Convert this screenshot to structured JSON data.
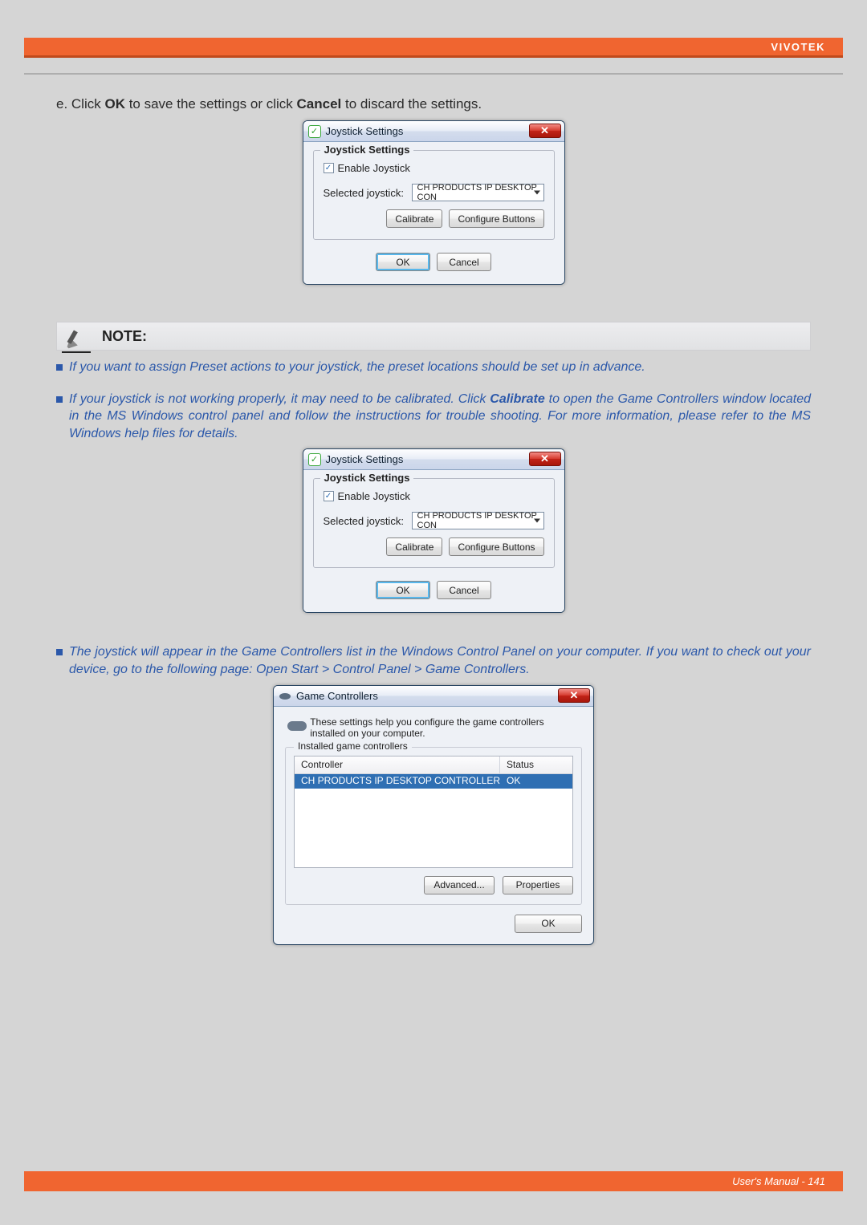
{
  "brand": "VIVOTEK",
  "step_line_pre": "e. Click ",
  "step_line_ok": "OK",
  "step_line_mid": " to save the settings or click ",
  "step_line_cancel": "Cancel",
  "step_line_post": " to discard the settings.",
  "joy_dialog": {
    "title": "Joystick Settings",
    "legend": "Joystick Settings",
    "enable_label": "Enable Joystick",
    "selected_label": "Selected joystick:",
    "selected_value": "CH PRODUCTS IP DESKTOP CON",
    "calibrate": "Calibrate",
    "configure": "Configure Buttons",
    "ok": "OK",
    "cancel": "Cancel"
  },
  "note_label": "NOTE:",
  "bullets": {
    "b1": "If you want to assign Preset actions to your joystick, the preset locations should be set up in advance.",
    "b2_pre": "If your joystick is not working properly, it may need to be calibrated. Click ",
    "b2_cal": "Calibrate",
    "b2_post": " to open the Game Controllers window located in the MS Windows control panel and follow the instructions for trouble shooting. For more information, please refer to the MS Windows help files for details.",
    "b3": "The joystick will appear in the Game Controllers list in the Windows Control Panel on your computer. If you want to check out your device, go to the following page: Open Start > Control Panel > Game Controllers."
  },
  "game_controllers": {
    "title": "Game Controllers",
    "description": "These settings help you configure the game controllers installed on your computer.",
    "legend": "Installed game controllers",
    "col_controller": "Controller",
    "col_status": "Status",
    "row_controller": "CH PRODUCTS IP DESKTOP CONTROLLER",
    "row_status": "OK",
    "advanced": "Advanced...",
    "properties": "Properties",
    "ok": "OK"
  },
  "footer": "User's Manual - 141"
}
